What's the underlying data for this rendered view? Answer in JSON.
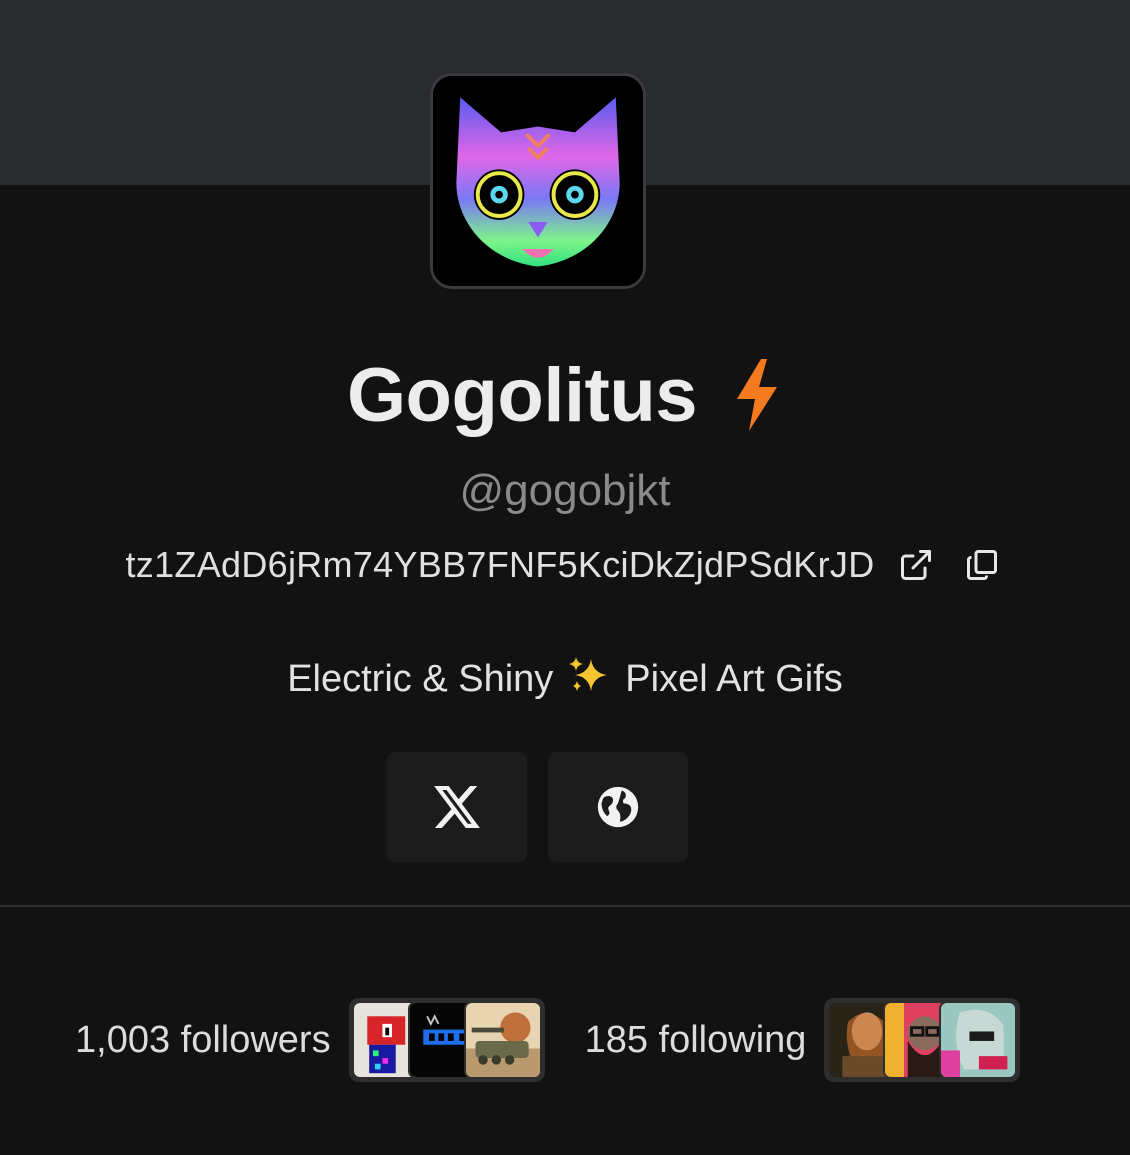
{
  "profile": {
    "display_name": "Gogolitus",
    "handle": "@gogobjkt",
    "address": "tz1ZAdD6jRm74YBB7FNF5KciDkZjdPSdKrJD",
    "bio_part1": "Electric & Shiny",
    "bio_part2": "Pixel Art Gifs",
    "verified_badge_icon": "lightning-bolt-icon",
    "accent_color": "#f47a20"
  },
  "address_actions": {
    "open_icon": "external-link-icon",
    "copy_icon": "copy-icon"
  },
  "socials": [
    {
      "name": "x-twitter",
      "icon": "x-logo-icon"
    },
    {
      "name": "website",
      "icon": "globe-icon"
    }
  ],
  "stats": {
    "followers_label": "1,003 followers",
    "following_label": "185 following"
  }
}
